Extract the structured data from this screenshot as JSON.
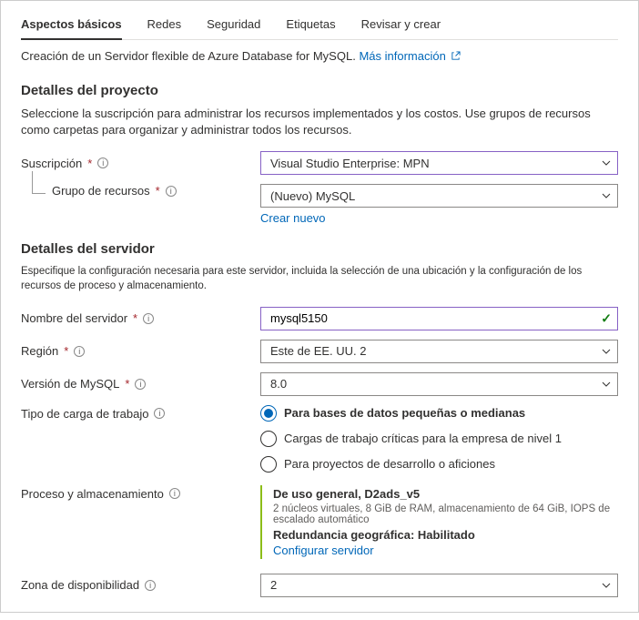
{
  "tabs": [
    "Aspectos básicos",
    "Redes",
    "Seguridad",
    "Etiquetas",
    "Revisar y crear"
  ],
  "activeTab": 0,
  "intro": {
    "text": "Creación de un Servidor flexible de Azure Database for MySQL.",
    "link": "Más información"
  },
  "project": {
    "heading": "Detalles del proyecto",
    "desc": "Seleccione la suscripción para administrar los recursos implementados y los costos. Use grupos de recursos como carpetas para organizar y administrar todos los recursos.",
    "subscription": {
      "label": "Suscripción",
      "value": "Visual Studio Enterprise: MPN"
    },
    "resourceGroup": {
      "label": "Grupo de recursos",
      "value": "(Nuevo) MySQL",
      "createNew": "Crear nuevo"
    }
  },
  "server": {
    "heading": "Detalles del servidor",
    "desc": "Especifique la configuración necesaria para este servidor, incluida la selección de una ubicación y la configuración de los recursos de proceso y almacenamiento.",
    "name": {
      "label": "Nombre del servidor",
      "value": "mysql5150"
    },
    "region": {
      "label": "Región",
      "value": "Este de EE. UU. 2"
    },
    "version": {
      "label": "Versión de MySQL",
      "value": "8.0"
    },
    "workload": {
      "label": "Tipo de carga de trabajo",
      "options": [
        "Para bases de datos pequeñas o medianas",
        "Cargas de trabajo críticas para la empresa de nivel 1",
        "Para proyectos de desarrollo o aficiones"
      ],
      "selected": 0
    },
    "compute": {
      "label": "Proceso y almacenamiento",
      "title": "De uso general, D2ads_v5",
      "sub": "2 núcleos virtuales, 8 GiB de RAM, almacenamiento de 64 GiB, IOPS de escalado automático",
      "redund": "Redundancia geográfica: Habilitado",
      "configure": "Configurar servidor"
    },
    "az": {
      "label": "Zona de disponibilidad",
      "value": "2"
    }
  }
}
